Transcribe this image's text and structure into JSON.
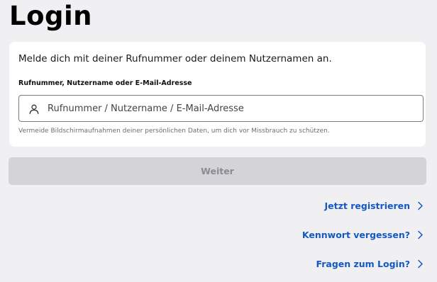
{
  "page": {
    "title": "Login"
  },
  "form": {
    "intro": "Melde dich mit deiner Rufnummer oder deinem Nutzernamen an.",
    "field_label": "Rufnummer, Nutzername oder E-Mail-Adresse",
    "input_value": "",
    "input_placeholder": "Rufnummer / Nutzername / E-Mail-Adresse",
    "input_icon": "user-icon",
    "hint": "Vermeide Bildschirmaufnahmen deiner persönlichen Daten, um dich vor Missbrauch zu schützen."
  },
  "submit_label": "Weiter",
  "links": {
    "register": "Jetzt registrieren",
    "forgot": "Kennwort vergessen?",
    "faq": "Fragen zum Login?",
    "chevron_icon": "chevron-right-icon"
  },
  "colors": {
    "background": "#f0f0f2",
    "card": "#ffffff",
    "link": "#1458c4",
    "button_disabled": "#d3d3d8",
    "button_text_disabled": "#8b8b93"
  }
}
